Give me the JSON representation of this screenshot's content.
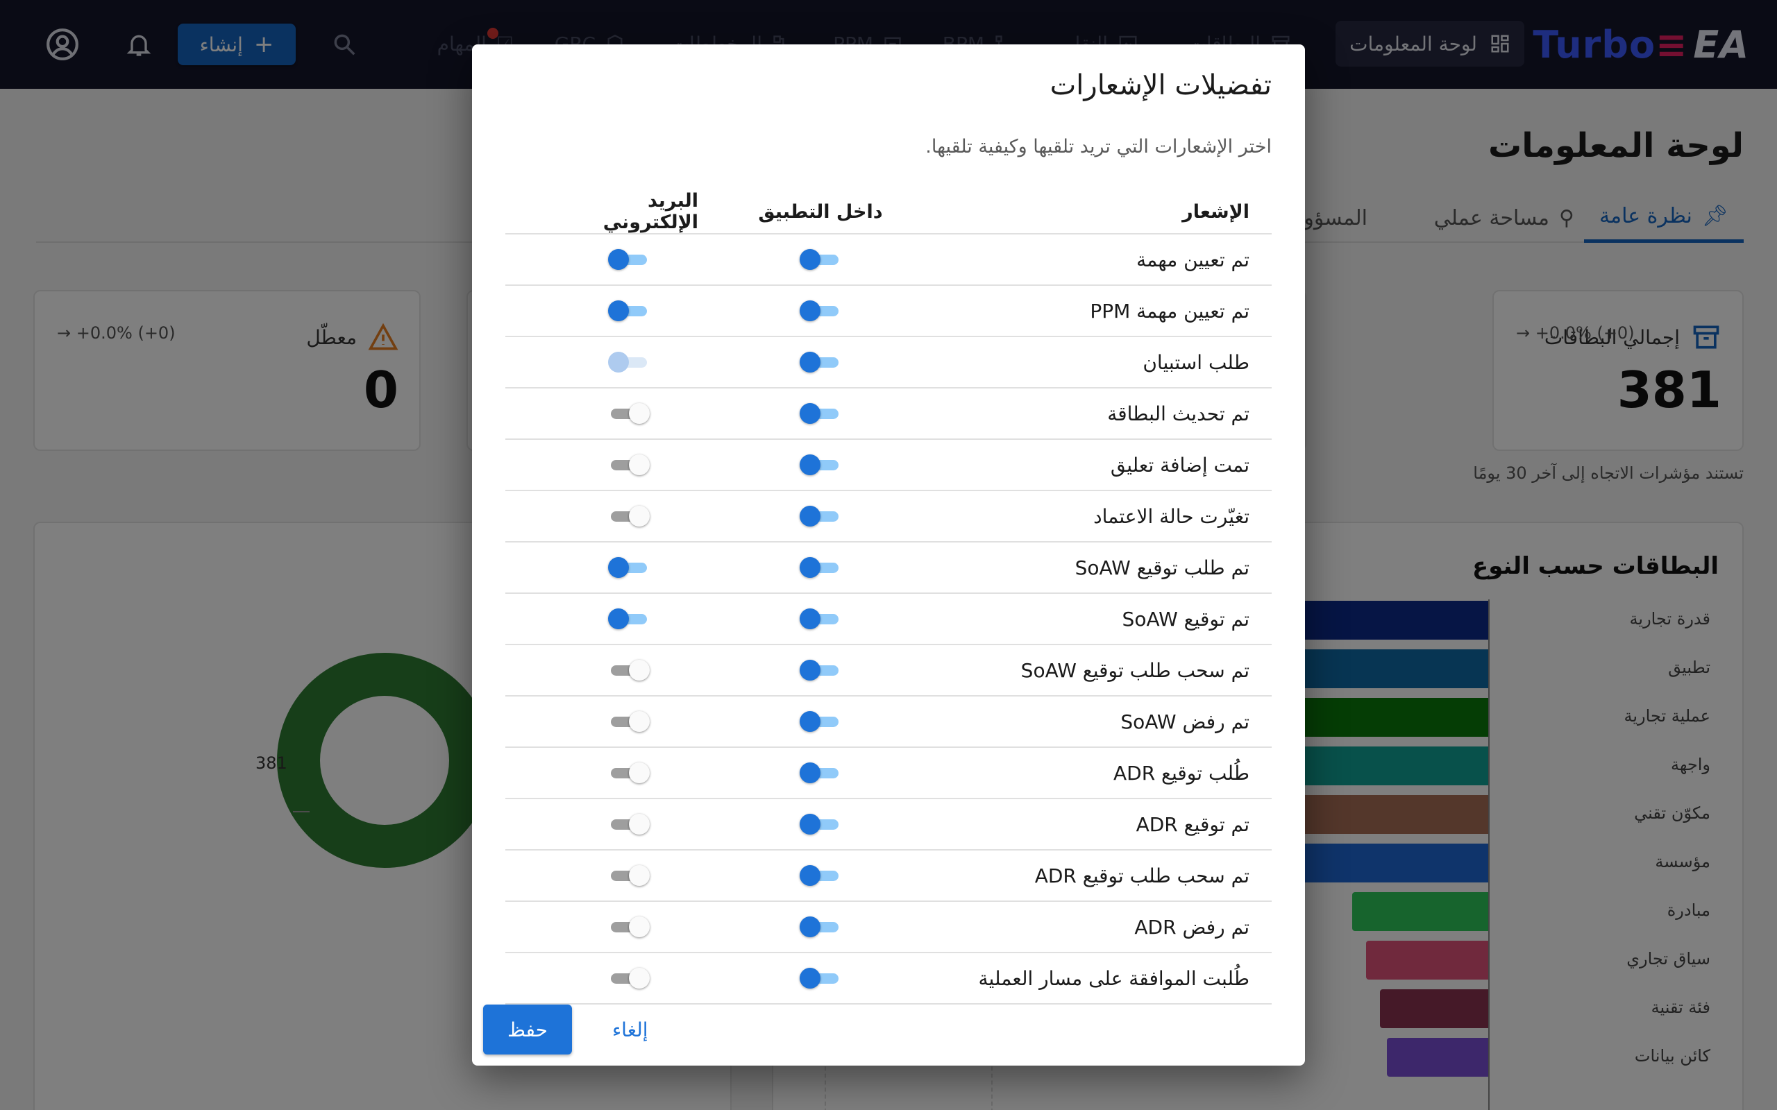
{
  "appbar": {
    "logo_part1": "Turbo",
    "logo_part2": "EA",
    "nav_active": "لوحة المعلومات",
    "nav_items": [
      "البطاقات",
      "النقل",
      "BPM",
      "PPM",
      "المخططات",
      "GRC"
    ],
    "tasks_label": "المهام",
    "create_label": "إنشاء"
  },
  "page": {
    "title": "لوحة المعلومات",
    "tabs": [
      "نظرة عامة",
      "مساحة عملي",
      "المسؤول"
    ],
    "stat_cards": [
      {
        "title": "إجمالي البطاقات",
        "value": "381",
        "trend": "→ +0.0% (+0)"
      },
      {
        "title": "معطّل",
        "value": "0",
        "trend": "→ +0.0% (+0)"
      }
    ],
    "trend_note": "تستند مؤشرات الاتجاه إلى آخر 30 يومًا",
    "donut_label": "381"
  },
  "chart_data": {
    "type": "bar",
    "title": "البطاقات حسب النوع",
    "categories": [
      "قدرة تجارية",
      "تطبيق",
      "عملية تجارية",
      "واجهة",
      "مكوّن تقني",
      "مؤسسة",
      "مبادرة",
      "سياق تجاري",
      "فئة تقنية",
      "كائن بيانات"
    ],
    "colors": [
      "#0d2a8a",
      "#0e6aa6",
      "#0a7a0a",
      "#10a396",
      "#a86f56",
      "#1f68d6",
      "#2ec95a",
      "#e0527a",
      "#8b3350",
      "#7a4fd6"
    ]
  },
  "dialog": {
    "title": "تفضيلات الإشعارات",
    "description": "اختر الإشعارات التي تريد تلقيها وكيفية تلقيها.",
    "col_notification": "الإشعار",
    "col_in_app": "داخل التطبيق",
    "col_email": "البريد الإلكتروني",
    "rows": [
      {
        "label": "تم تعيين مهمة",
        "in_app": "on",
        "email": "on"
      },
      {
        "label": "تم تعيين مهمة PPM",
        "in_app": "on",
        "email": "on"
      },
      {
        "label": "طلب استبيان",
        "in_app": "on",
        "email": "disabled"
      },
      {
        "label": "تم تحديث البطاقة",
        "in_app": "on",
        "email": "off"
      },
      {
        "label": "تمت إضافة تعليق",
        "in_app": "on",
        "email": "off"
      },
      {
        "label": "تغيّرت حالة الاعتماد",
        "in_app": "on",
        "email": "off"
      },
      {
        "label": "تم طلب توقيع SoAW",
        "in_app": "on",
        "email": "on"
      },
      {
        "label": "تم توقيع SoAW",
        "in_app": "on",
        "email": "on"
      },
      {
        "label": "تم سحب طلب توقيع SoAW",
        "in_app": "on",
        "email": "off"
      },
      {
        "label": "تم رفض SoAW",
        "in_app": "on",
        "email": "off"
      },
      {
        "label": "طُلب توقيع ADR",
        "in_app": "on",
        "email": "off"
      },
      {
        "label": "تم توقيع ADR",
        "in_app": "on",
        "email": "off"
      },
      {
        "label": "تم سحب طلب توقيع ADR",
        "in_app": "on",
        "email": "off"
      },
      {
        "label": "تم رفض ADR",
        "in_app": "on",
        "email": "off"
      },
      {
        "label": "طُلبت الموافقة على مسار العملية",
        "in_app": "on",
        "email": "off"
      }
    ],
    "save_label": "حفظ",
    "cancel_label": "إلغاء"
  }
}
